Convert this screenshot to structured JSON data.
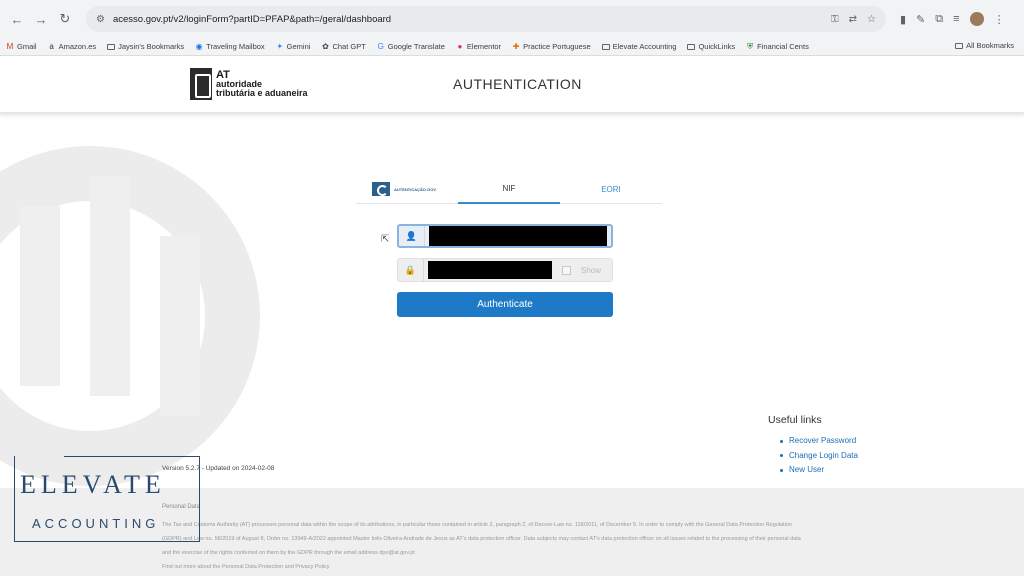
{
  "browser": {
    "url": "acesso.gov.pt/v2/loginForm?partID=PFAP&path=/geral/dashboard",
    "bookmarks": [
      {
        "label": "Gmail",
        "icon": "gmail-icon"
      },
      {
        "label": "Amazon.es",
        "icon": "amazon-icon"
      },
      {
        "label": "Jaysin's Bookmarks",
        "icon": "folder-icon"
      },
      {
        "label": "Traveling Mailbox",
        "icon": "globe-icon"
      },
      {
        "label": "Gemini",
        "icon": "sparkle-icon"
      },
      {
        "label": "Chat GPT",
        "icon": "chatgpt-icon"
      },
      {
        "label": "Google Translate",
        "icon": "translate-icon"
      },
      {
        "label": "Elementor",
        "icon": "elementor-icon"
      },
      {
        "label": "Practice Portuguese",
        "icon": "puzzle-icon"
      },
      {
        "label": "Elevate Accounting",
        "icon": "folder-icon"
      },
      {
        "label": "QuickLinks",
        "icon": "folder-icon"
      },
      {
        "label": "Financial Cents",
        "icon": "shield-icon"
      }
    ],
    "all_bookmarks": "All Bookmarks"
  },
  "header": {
    "logo_abbr": "AT",
    "logo_line1": "autoridade",
    "logo_line2": "tributária e aduaneira",
    "title": "AUTHENTICATION"
  },
  "login": {
    "tabs": {
      "logo_text": "AUTENTICAÇÃO.GOV",
      "nif": "NIF",
      "eori": "EORI"
    },
    "show_label": "Show",
    "authenticate_label": "Authenticate"
  },
  "useful_links": {
    "title": "Useful links",
    "items": [
      "Recover Password",
      "Change Login Data",
      "New User"
    ]
  },
  "version": "Version 5.2.7 - Updated on 2024-02-08",
  "footer": {
    "title": "Personal Data",
    "line1": "The Tax and Customs Authority (AT) processes personal data within the scope of its attributions, in particular those contained in article 2, paragraph 2, of Decree-Law no. 118/2011, of December 5. In order to comply with the General Data Protection Regulation",
    "line2": "(GDPR) and Law no. 58/2019 of August 8, Order no. 13949-A/2022 appointed Master Inês Oliveira Andrade de Jesus as AT's data protection officer. Data subjects may contact AT's data protection officer on all issues related to the processing of their personal data",
    "line3": "and the exercise of the rights conferred on them by the GDPR through the email address dpo@at.gov.pt",
    "line4": "Find out more about the Personal Data Protection and Privacy Policy"
  },
  "overlay": {
    "elevate": "ELEVATE",
    "accounting": "ACCOUNTING"
  }
}
